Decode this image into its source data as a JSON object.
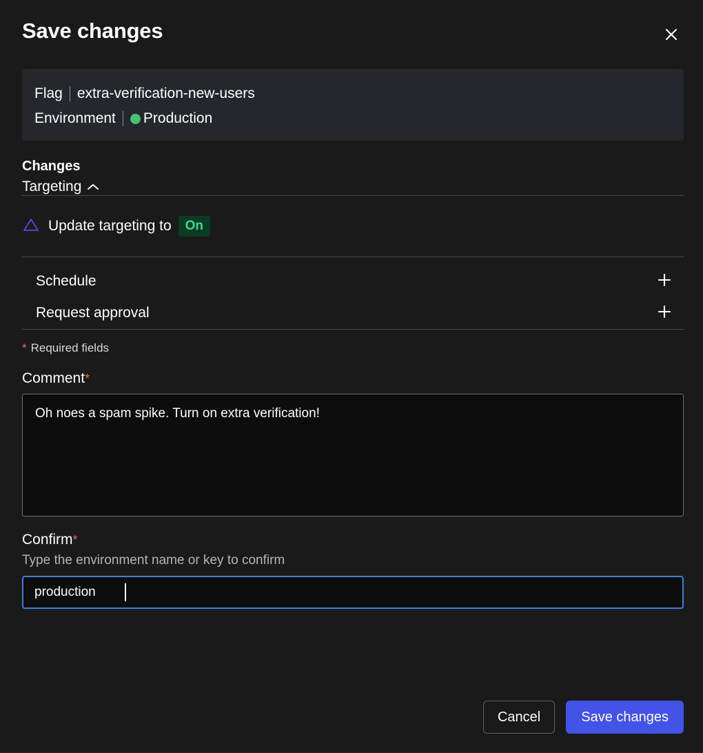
{
  "modal": {
    "title": "Save changes",
    "close_icon": "close-icon"
  },
  "context": {
    "flag_label": "Flag",
    "flag_name": "extra-verification-new-users",
    "environment_label": "Environment",
    "environment_name": "Production",
    "environment_color": "#43c478"
  },
  "changes": {
    "heading": "Changes",
    "section_label": "Targeting",
    "section_chevron": "chevron-up-icon",
    "change_icon": "triangle-outline-icon",
    "change_text": "Update targeting to",
    "change_value": "On",
    "change_value_bg": "#0b3b24",
    "change_value_color": "#3fd98b"
  },
  "options": [
    {
      "label": "Schedule",
      "icon": "plus-icon"
    },
    {
      "label": "Request approval",
      "icon": "plus-icon"
    }
  ],
  "form": {
    "required_note": "Required fields",
    "required_marker": "*",
    "comment_label": "Comment",
    "comment_value": "Oh noes a spam spike. Turn on extra verification!",
    "comment_placeholder": "",
    "confirm_label": "Confirm",
    "confirm_hint": "Type the environment name or key to confirm",
    "confirm_value": "production",
    "confirm_placeholder": "",
    "required_color": "#e8695a"
  },
  "footer": {
    "cancel_label": "Cancel",
    "save_label": "Save changes",
    "save_color": "#4353e8"
  }
}
